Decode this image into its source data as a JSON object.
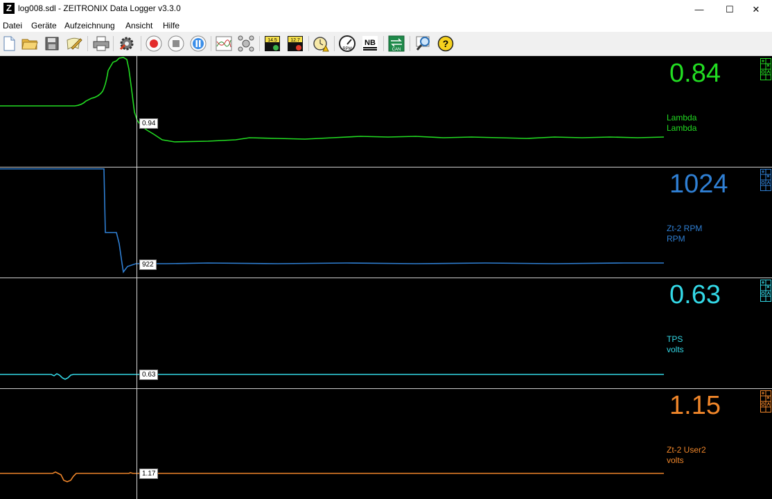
{
  "window": {
    "title": "log008.sdl - ZEITRONIX Data Logger v3.3.0",
    "logo_letter": "Z",
    "minimize_glyph": "—",
    "maximize_glyph": "☐",
    "close_glyph": "✕"
  },
  "menu": [
    "Datei",
    "Geräte",
    "Aufzeichnung",
    "Ansicht",
    "Hilfe"
  ],
  "toolbar": {
    "buttons": [
      {
        "icon": "new-file-icon"
      },
      {
        "icon": "open-folder-icon"
      },
      {
        "icon": "save-disk-icon"
      },
      {
        "icon": "notes-edit-icon"
      },
      {
        "icon": "printer-icon"
      },
      {
        "icon": "settings-gear-icon"
      },
      {
        "icon": "record-icon"
      },
      {
        "icon": "stop-icon"
      },
      {
        "icon": "pause-icon"
      },
      {
        "icon": "graph-lines-icon"
      },
      {
        "icon": "network-icon"
      },
      {
        "icon": "afr-setpoint-up-icon",
        "label": "14.5"
      },
      {
        "icon": "afr-setpoint-down-icon",
        "label": "12.7"
      },
      {
        "icon": "alarm-clock-warning-icon"
      },
      {
        "icon": "rpm-gauge-icon",
        "label": "RPM"
      },
      {
        "icon": "nb-narrowband-icon",
        "label": "NB"
      },
      {
        "icon": "can-bus-icon",
        "label": "CAN"
      },
      {
        "icon": "zoom-magnifier-icon"
      },
      {
        "icon": "help-icon",
        "label": "?"
      }
    ]
  },
  "channels": [
    {
      "name": "Lambda",
      "unit": "Lambda",
      "current_value": "0.84",
      "cursor_value": "0.94",
      "color": "#22dd22"
    },
    {
      "name": "Zt-2 RPM",
      "unit": "RPM",
      "current_value": "1024",
      "cursor_value": "922",
      "color": "#2f7fd3"
    },
    {
      "name": "TPS",
      "unit": "volts",
      "current_value": "0.63",
      "cursor_value": "0.63",
      "color": "#33d8e6"
    },
    {
      "name": "Zt-2 User2",
      "unit": "volts",
      "current_value": "1.15",
      "cursor_value": "1.17",
      "color": "#f0862a"
    }
  ]
}
